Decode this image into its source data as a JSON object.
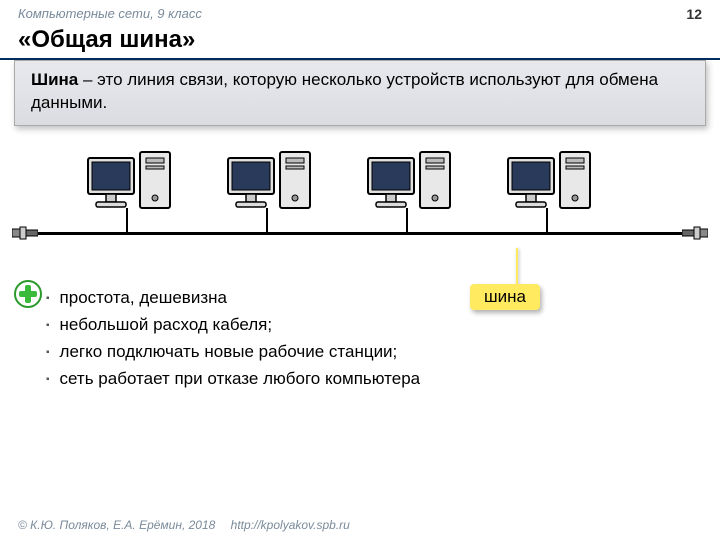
{
  "header": {
    "course": "Компьютерные сети, 9 класс",
    "page": "12"
  },
  "title": "«Общая шина»",
  "definition": {
    "term": "Шина",
    "text": " – это линия связи, которую несколько устройств используют для обмена данными."
  },
  "bus_label": "шина",
  "advantages": [
    "простота, дешевизна",
    "небольшой расход кабеля;",
    "легко подключать новые рабочие станции;",
    "сеть работает при отказе любого компьютера"
  ],
  "footer": {
    "copyright": "© К.Ю. Поляков, Е.А. Ерёмин, 2018",
    "url": "http://kpolyakov.spb.ru"
  },
  "diagram": {
    "type": "bus-topology",
    "node_count": 4
  }
}
